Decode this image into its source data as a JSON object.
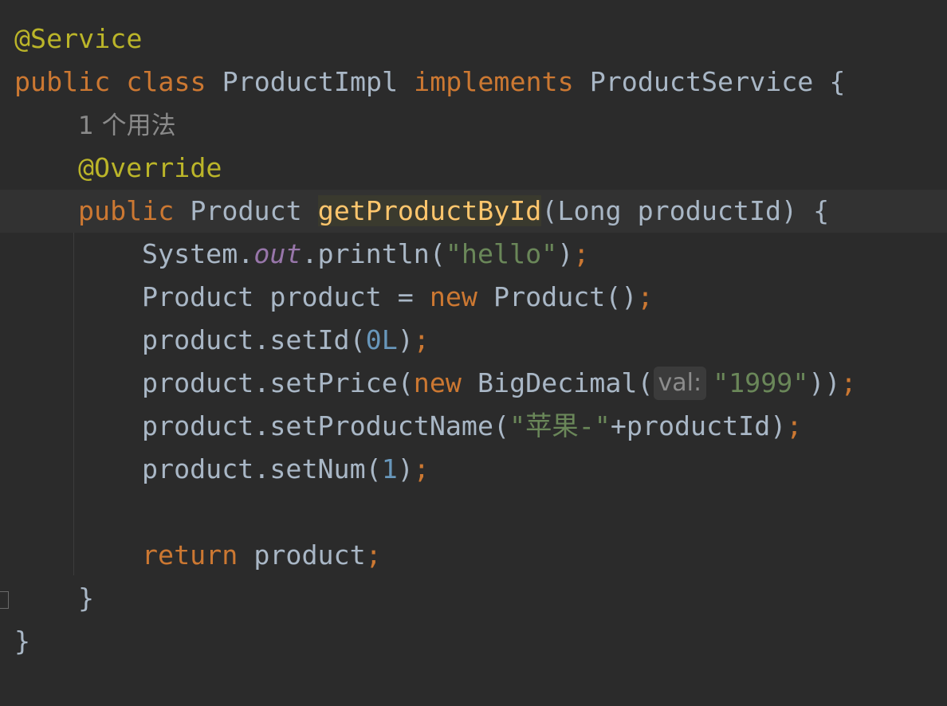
{
  "code": {
    "line1_annotation": "@Service",
    "line2": {
      "kw_public": "public",
      "kw_class": "class",
      "class_name": "ProductImpl",
      "kw_implements": "implements",
      "interface_name": "ProductService",
      "brace_open": "{"
    },
    "usage_hint": "1 个用法",
    "line4_annotation": "@Override",
    "line5": {
      "kw_public": "public",
      "return_type": "Product",
      "method_name": "getProductById",
      "params_open": "(Long productId) {"
    },
    "line6": {
      "system": "System.",
      "out": "out",
      "println": ".println(",
      "string": "\"hello\"",
      "close": ")",
      "semi": ";"
    },
    "line7": {
      "decl": "Product product = ",
      "kw_new": "new",
      "ctor": " Product()",
      "semi": ";"
    },
    "line8": {
      "call": "product.setId(",
      "num": "0L",
      "close": ")",
      "semi": ";"
    },
    "line9": {
      "call": "product.setPrice(",
      "kw_new": "new",
      "ctor": " BigDecimal(",
      "param_hint": "val:",
      "string": "\"1999\"",
      "close": "))",
      "semi": ";"
    },
    "line10": {
      "call": "product.setProductName(",
      "string": "\"苹果-\"",
      "rest": "+productId)",
      "semi": ";"
    },
    "line11": {
      "call": "product.setNum(",
      "num": "1",
      "close": ")",
      "semi": ";"
    },
    "line13": {
      "kw_return": "return",
      "value": " product",
      "semi": ";"
    },
    "line14_brace": "}",
    "line15_brace": "}"
  },
  "icons": {
    "intention": "lightbulb-icon",
    "fold": "fold-marker-icon"
  },
  "colors": {
    "background": "#2b2b2b",
    "keyword": "#cc7832",
    "annotation": "#bbb529",
    "function": "#ffc66d",
    "string": "#6a8759",
    "number": "#6897bb",
    "static_field": "#9876aa",
    "text": "#a9b7c6"
  }
}
